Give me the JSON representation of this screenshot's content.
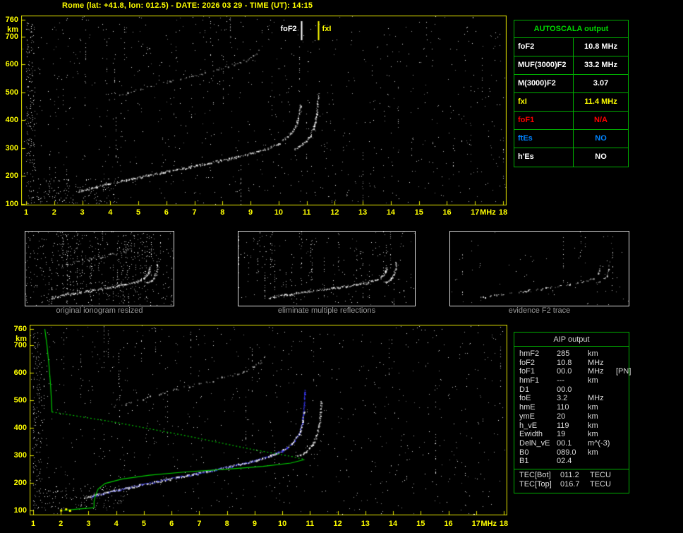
{
  "header": {
    "title": "Rome (lat: +41.8, lon: 012.5) - DATE: 2026 03 29 - TIME (UT): 14:15"
  },
  "colors": {
    "background": "#000000",
    "axis_yellow": "#ffff00",
    "plot_frame_yellow": "#e6e600",
    "table_border_green": "#00b000",
    "autoscala_title_green": "#00d800",
    "trace_white": "#ffffff",
    "second_hop_gray": "#c8c8c8",
    "restored_trace_blue": "#3c3cff",
    "profile_green": "#00cc00",
    "fof1_red": "#ff0000",
    "ftes_blue": "#0084ff",
    "caption_gray": "#999999",
    "aip_text": "#dcdcdc"
  },
  "autoscala_table": {
    "title": "AUTOSCALA output",
    "rows": [
      {
        "label": "foF2",
        "value": "10.8 MHz",
        "color": "#ffffff"
      },
      {
        "label": "MUF(3000)F2",
        "value": "33.2 MHz",
        "color": "#ffffff"
      },
      {
        "label": "M(3000)F2",
        "value": "3.07",
        "color": "#ffffff"
      },
      {
        "label": "fxI",
        "value": "11.4 MHz",
        "color": "#ffff00"
      },
      {
        "label": "foF1",
        "value": "N/A",
        "color": "#ff0000"
      },
      {
        "label": "ftEs",
        "value": "NO",
        "color": "#0084ff"
      },
      {
        "label": "h'Es",
        "value": "NO",
        "color": "#ffffff"
      }
    ]
  },
  "aip_table": {
    "title": "AIP output",
    "rows": [
      {
        "name": "hmF2",
        "value": "285",
        "unit": "km",
        "extra": ""
      },
      {
        "name": "foF2",
        "value": "10.8",
        "unit": "MHz",
        "extra": ""
      },
      {
        "name": "foF1",
        "value": "00.0",
        "unit": "MHz",
        "extra": "[PN]"
      },
      {
        "name": "hmF1",
        "value": "---",
        "unit": "km",
        "extra": ""
      },
      {
        "name": "D1",
        "value": "00.0",
        "unit": "",
        "extra": ""
      },
      {
        "name": "foE",
        "value": "3.2",
        "unit": "MHz",
        "extra": ""
      },
      {
        "name": "hmE",
        "value": "110",
        "unit": "km",
        "extra": ""
      },
      {
        "name": "ymE",
        "value": "20",
        "unit": "km",
        "extra": ""
      },
      {
        "name": "h_vE",
        "value": "119",
        "unit": "km",
        "extra": ""
      },
      {
        "name": "Ewidth",
        "value": "19",
        "unit": "km",
        "extra": ""
      },
      {
        "name": "DelN_vE",
        "value": "00.1",
        "unit": "m^(-3)",
        "extra": ""
      },
      {
        "name": "B0",
        "value": "089.0",
        "unit": "km",
        "extra": ""
      },
      {
        "name": "B1",
        "value": "02.4",
        "unit": "",
        "extra": ""
      }
    ],
    "tec_rows": [
      {
        "name": "TEC[Bot]",
        "value": "011.2",
        "unit": "TECU"
      },
      {
        "name": "TEC[Top]",
        "value": "016.7",
        "unit": "TECU"
      }
    ]
  },
  "thumbnails": [
    {
      "caption": "original ionogram resized"
    },
    {
      "caption": "eliminate multiple reflections"
    },
    {
      "caption": "evidence F2 trace"
    }
  ],
  "chart_data": [
    {
      "id": "main_ionogram",
      "type": "scatter",
      "title": "Rome ionogram 2026-03-29 14:15 UT",
      "xlabel": "MHz",
      "ylabel": "km",
      "x_range": [
        1,
        18
      ],
      "y_range": [
        100,
        760
      ],
      "x_ticks": [
        1,
        2,
        3,
        4,
        5,
        6,
        7,
        8,
        9,
        10,
        11,
        12,
        13,
        14,
        15,
        16,
        17,
        18
      ],
      "y_ticks": [
        100,
        200,
        300,
        400,
        500,
        600,
        700,
        760
      ],
      "markers": [
        {
          "name": "foF2",
          "value_mhz": 10.8,
          "color": "#ffffff",
          "label_side": "left"
        },
        {
          "name": "fxI",
          "value_mhz": 11.4,
          "color": "#ffff00",
          "label_side": "right"
        }
      ],
      "series": [
        {
          "name": "F2 layer O-mode echo trace",
          "color": "#ffffff",
          "points": [
            [
              2.85,
              147
            ],
            [
              3.3,
              158
            ],
            [
              3.9,
              172
            ],
            [
              4.8,
              192
            ],
            [
              5.8,
              213
            ],
            [
              6.8,
              233
            ],
            [
              7.8,
              254
            ],
            [
              8.8,
              277
            ],
            [
              9.5,
              297
            ],
            [
              10.0,
              318
            ],
            [
              10.35,
              345
            ],
            [
              10.6,
              380
            ],
            [
              10.72,
              420
            ],
            [
              10.78,
              462
            ]
          ]
        },
        {
          "name": "F2 layer X-mode echo trace",
          "color": "#ffffff",
          "points": [
            [
              10.55,
              298
            ],
            [
              10.85,
              315
            ],
            [
              11.1,
              342
            ],
            [
              11.25,
              378
            ],
            [
              11.35,
              425
            ],
            [
              11.4,
              500
            ]
          ]
        },
        {
          "name": "second-hop multiple reflection trace",
          "color": "#c8c8c8",
          "points": [
            [
              3.9,
              478
            ],
            [
              4.6,
              498
            ],
            [
              5.3,
              518
            ],
            [
              6.1,
              540
            ],
            [
              7.0,
              562
            ],
            [
              7.9,
              585
            ],
            [
              8.7,
              610
            ],
            [
              9.2,
              638
            ],
            [
              9.35,
              658
            ]
          ]
        }
      ]
    },
    {
      "id": "profile_ionogram",
      "type": "scatter",
      "title": "ionogram with Autoscala restored trace and electron density profile",
      "xlabel": "MHz",
      "ylabel": "km",
      "x_range": [
        1,
        18
      ],
      "y_range": [
        100,
        760
      ],
      "x_ticks": [
        1,
        2,
        3,
        4,
        5,
        6,
        7,
        8,
        9,
        10,
        11,
        12,
        13,
        14,
        15,
        16,
        17,
        18
      ],
      "y_ticks": [
        100,
        200,
        300,
        400,
        500,
        600,
        700,
        760
      ],
      "series": [
        {
          "name": "Autoscala restored F2 trace",
          "color": "#3c3cff",
          "points": [
            [
              3.1,
              152
            ],
            [
              3.9,
              172
            ],
            [
              4.8,
              192
            ],
            [
              5.8,
              213
            ],
            [
              6.8,
              233
            ],
            [
              7.8,
              254
            ],
            [
              8.8,
              277
            ],
            [
              9.5,
              297
            ],
            [
              10.0,
              318
            ],
            [
              10.35,
              345
            ],
            [
              10.6,
              380
            ],
            [
              10.72,
              425
            ],
            [
              10.78,
              480
            ],
            [
              10.8,
              540
            ]
          ]
        },
        {
          "name": "F2 layer O-mode echo trace",
          "color": "#ffffff",
          "points": [
            [
              2.85,
              147
            ],
            [
              3.3,
              158
            ],
            [
              3.9,
              172
            ],
            [
              4.8,
              192
            ],
            [
              5.8,
              213
            ],
            [
              6.8,
              233
            ],
            [
              7.8,
              254
            ],
            [
              8.8,
              277
            ],
            [
              9.5,
              297
            ],
            [
              10.0,
              318
            ],
            [
              10.35,
              345
            ],
            [
              10.6,
              380
            ],
            [
              10.72,
              420
            ],
            [
              10.78,
              462
            ]
          ]
        },
        {
          "name": "F2 layer X-mode echo trace",
          "color": "#ffffff",
          "points": [
            [
              10.55,
              298
            ],
            [
              10.85,
              315
            ],
            [
              11.1,
              342
            ],
            [
              11.25,
              378
            ],
            [
              11.35,
              425
            ],
            [
              11.4,
              500
            ]
          ]
        },
        {
          "name": "second-hop multiple reflection trace",
          "color": "#c8c8c8",
          "points": [
            [
              3.9,
              478
            ],
            [
              4.6,
              498
            ],
            [
              5.3,
              518
            ],
            [
              6.1,
              540
            ],
            [
              7.0,
              562
            ],
            [
              7.9,
              585
            ],
            [
              8.7,
              610
            ],
            [
              9.2,
              638
            ],
            [
              9.35,
              658
            ]
          ]
        }
      ],
      "profile": {
        "name": "electron density profile (plasma frequency vs height)",
        "color": "#00cc00",
        "hmF2_km": 285,
        "foF2_mhz": 10.8,
        "foE_mhz": 3.2,
        "hmE_km": 110,
        "topside_solid": [
          [
            1.42,
            760
          ],
          [
            1.5,
            700
          ],
          [
            1.57,
            630
          ],
          [
            1.63,
            555
          ],
          [
            1.66,
            500
          ],
          [
            1.68,
            458
          ]
        ],
        "topside_dotted": [
          [
            1.68,
            458
          ],
          [
            4.0,
            420
          ],
          [
            6.5,
            372
          ],
          [
            9.0,
            320
          ],
          [
            10.4,
            295
          ],
          [
            10.8,
            285
          ]
        ],
        "bottomside": [
          [
            10.8,
            285
          ],
          [
            10.3,
            272
          ],
          [
            9.3,
            260
          ],
          [
            8.0,
            250
          ],
          [
            6.5,
            240
          ],
          [
            5.2,
            228
          ],
          [
            4.2,
            214
          ],
          [
            3.6,
            198
          ],
          [
            3.35,
            178
          ],
          [
            3.25,
            155
          ],
          [
            3.2,
            132
          ],
          [
            3.2,
            112
          ]
        ],
        "e_layer": [
          [
            2.1,
            100
          ],
          [
            2.6,
            105
          ],
          [
            3.0,
            108
          ],
          [
            3.2,
            110
          ]
        ],
        "es_marks": {
          "color": "#ffff00",
          "points": [
            [
              2.0,
              101
            ],
            [
              2.18,
              105
            ],
            [
              2.32,
              100
            ]
          ]
        }
      }
    },
    {
      "id": "thumb_original",
      "type": "scatter",
      "caption": "original ionogram resized",
      "derived_from": "main_ionogram",
      "x_range": [
        1,
        12.5
      ],
      "y_range": [
        90,
        780
      ]
    },
    {
      "id": "thumb_no_multiples",
      "type": "scatter",
      "caption": "eliminate multiple reflections",
      "derived_from": "main_ionogram",
      "x_range": [
        1,
        12.5
      ],
      "y_range": [
        90,
        780
      ]
    },
    {
      "id": "thumb_f2_trace",
      "type": "scatter",
      "caption": "evidence F2 trace",
      "derived_from": "main_ionogram",
      "x_range": [
        1,
        12.5
      ],
      "y_range": [
        90,
        780
      ]
    }
  ]
}
